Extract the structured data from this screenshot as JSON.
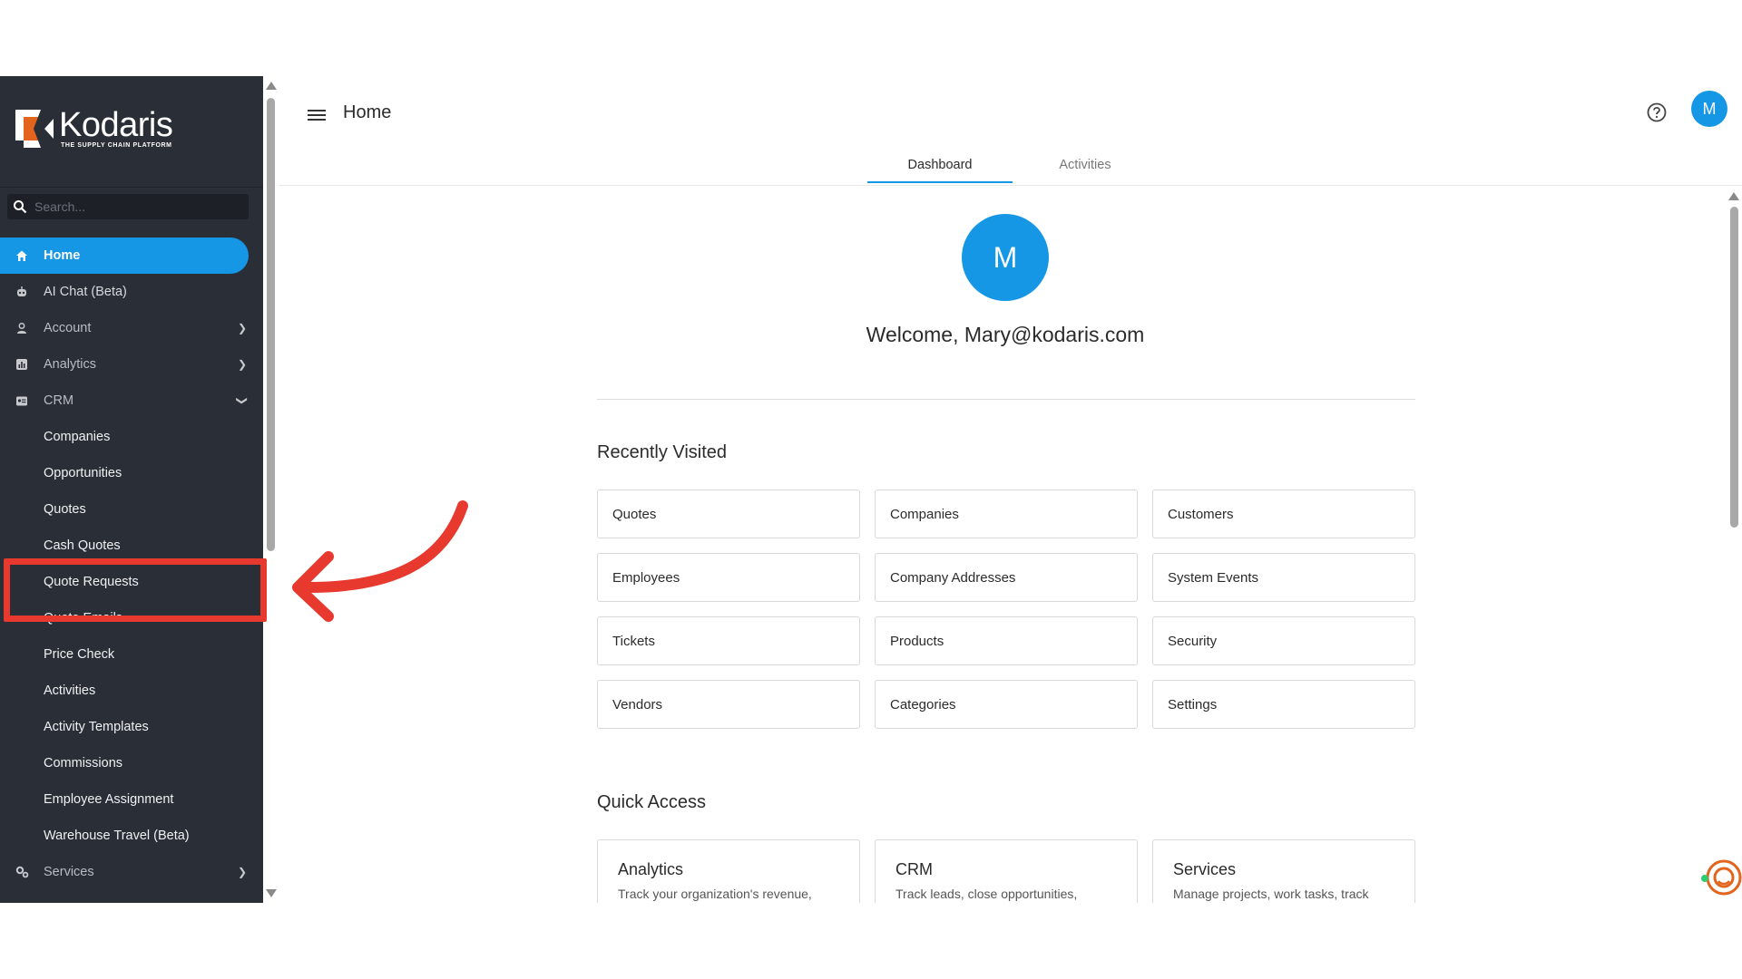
{
  "brand": {
    "name": "Kodaris",
    "tagline": "THE SUPPLY CHAIN PLATFORM"
  },
  "search": {
    "placeholder": "Search..."
  },
  "sidebar": {
    "items": [
      {
        "label": "Home",
        "icon": "home-icon"
      },
      {
        "label": "AI Chat (Beta)",
        "icon": "robot-icon"
      },
      {
        "label": "Account",
        "icon": "person-icon"
      },
      {
        "label": "Analytics",
        "icon": "analytics-icon"
      },
      {
        "label": "CRM",
        "icon": "crm-icon"
      },
      {
        "label": "Services",
        "icon": "gears-icon"
      }
    ],
    "crm_children": [
      "Companies",
      "Opportunities",
      "Quotes",
      "Cash Quotes",
      "Quote Requests",
      "Quote Emails",
      "Price Check",
      "Activities",
      "Activity Templates",
      "Commissions",
      "Employee Assignment",
      "Warehouse Travel (Beta)"
    ]
  },
  "header": {
    "title": "Home",
    "avatar_initial": "M"
  },
  "tabs": [
    "Dashboard",
    "Activities"
  ],
  "welcome": {
    "avatar_initial": "M",
    "text": "Welcome, Mary@kodaris.com"
  },
  "recently_visited": {
    "title": "Recently Visited",
    "items": [
      "Quotes",
      "Companies",
      "Customers",
      "Employees",
      "Company Addresses",
      "System Events",
      "Tickets",
      "Products",
      "Security",
      "Vendors",
      "Categories",
      "Settings"
    ]
  },
  "quick_access": {
    "title": "Quick Access",
    "items": [
      {
        "title": "Analytics",
        "desc": "Track your organization's revenue,"
      },
      {
        "title": "CRM",
        "desc": "Track leads, close opportunities,"
      },
      {
        "title": "Services",
        "desc": "Manage projects, work tasks, track"
      }
    ]
  },
  "colors": {
    "accent": "#1597e5",
    "sidebar": "#2a2e37",
    "annotation": "#e8392e"
  }
}
